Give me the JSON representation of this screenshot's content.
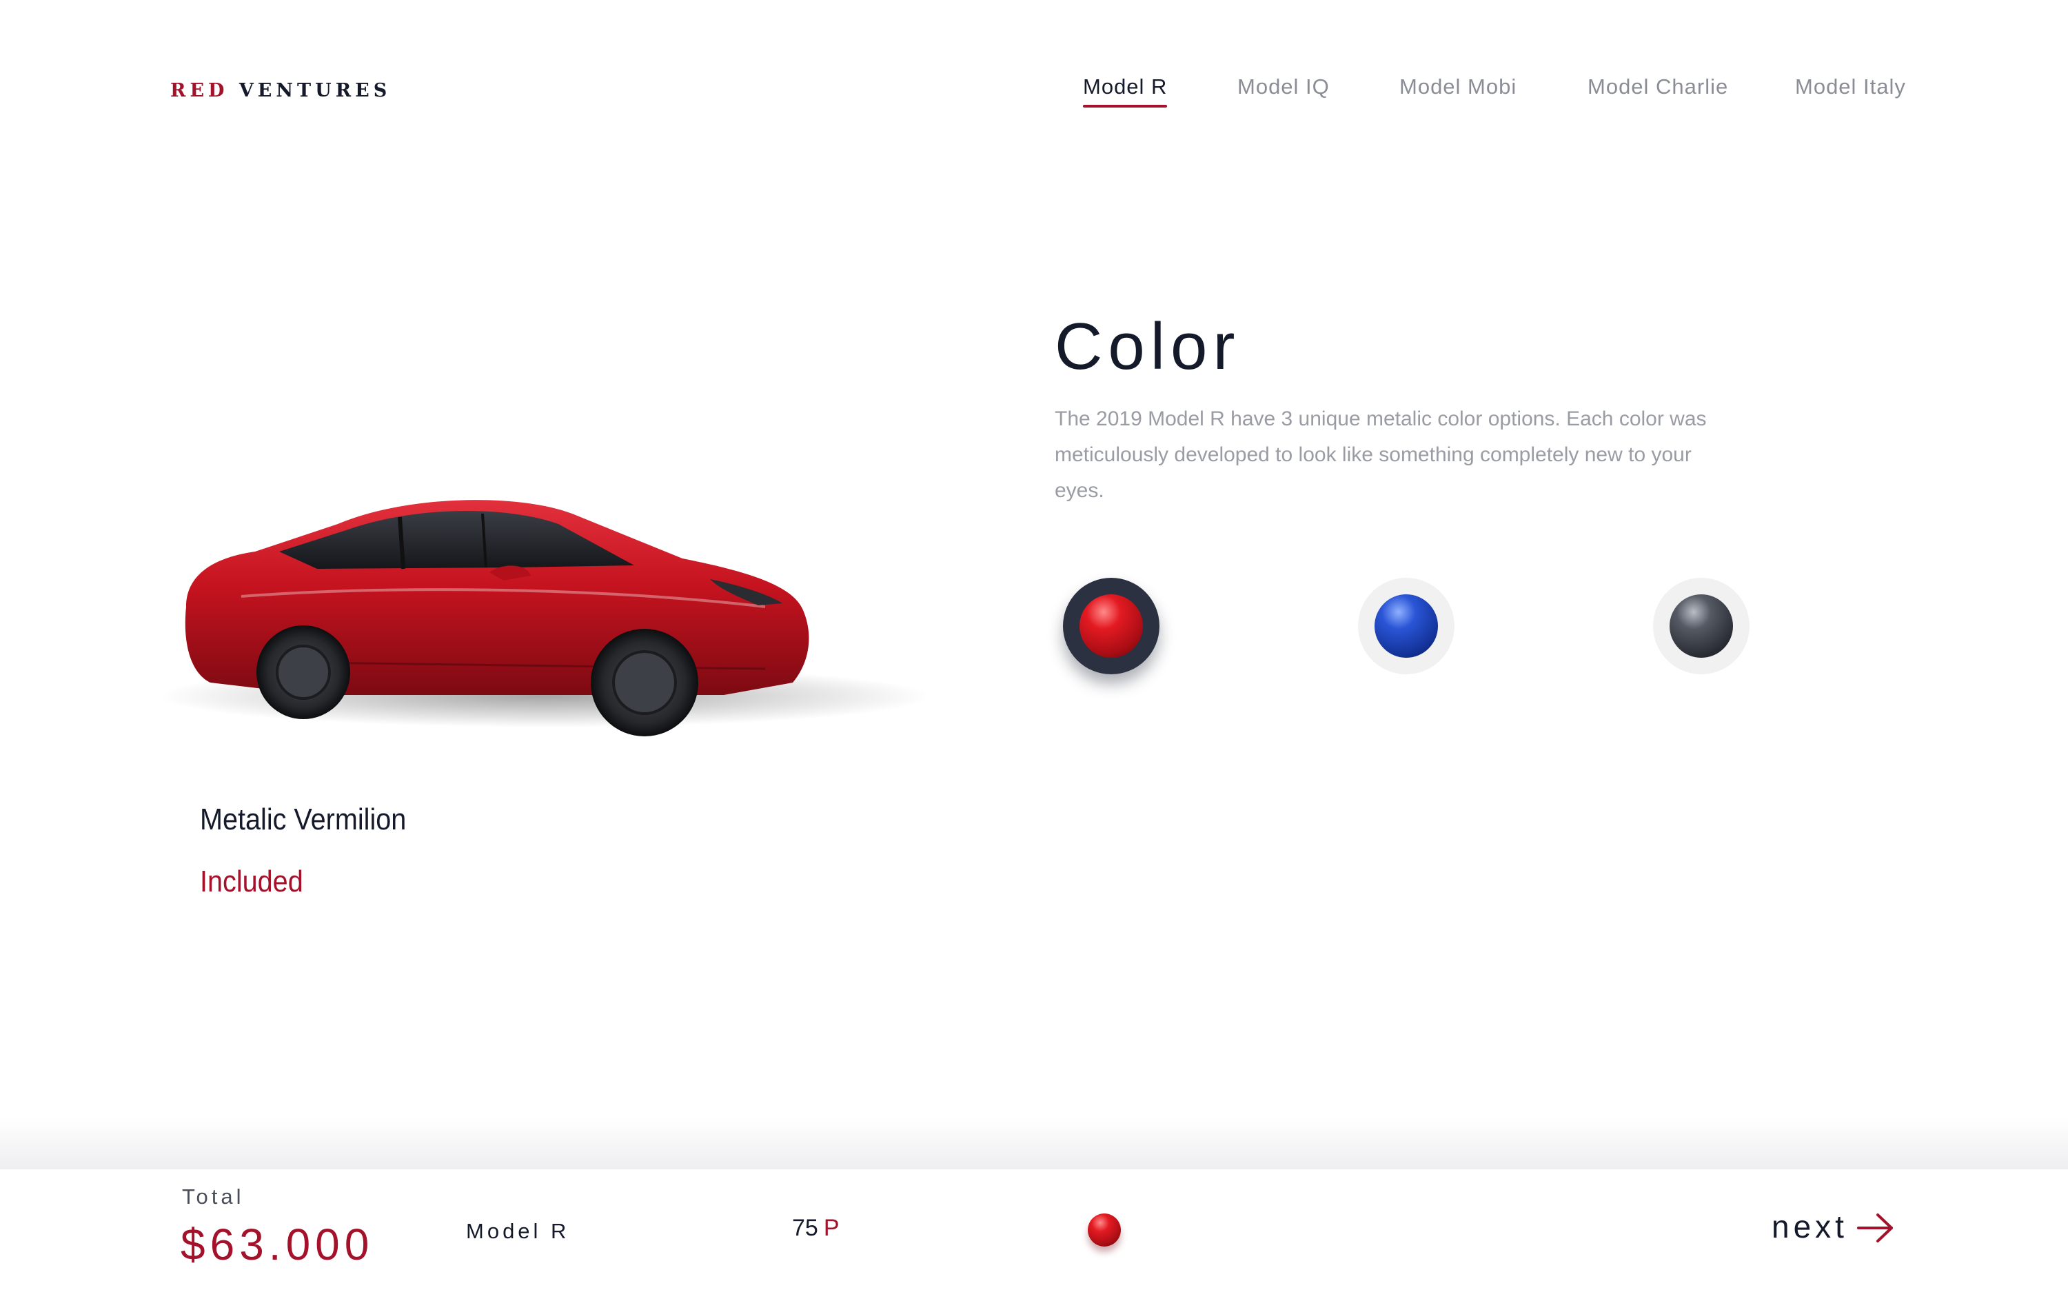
{
  "brand": {
    "part1": "RED",
    "part2": "VENTURES",
    "accent_color": "#a3122a",
    "dark_color": "#141a2a"
  },
  "nav": {
    "items": [
      {
        "label": "Model R",
        "active": true
      },
      {
        "label": "Model IQ",
        "active": false
      },
      {
        "label": "Model Mobi",
        "active": false
      },
      {
        "label": "Model Charlie",
        "active": false
      },
      {
        "label": "Model Italy",
        "active": false
      }
    ]
  },
  "section": {
    "title": "Color",
    "description": "The 2019 Model R have 3 unique metalic color options. Each color was meticulously developed to look like something completely new to your eyes."
  },
  "selected_color": {
    "name": "Metalic Vermilion",
    "price_note": "Included"
  },
  "swatches": [
    {
      "icon": "red-paint-sphere-icon",
      "color": "#d4151c",
      "selected": true
    },
    {
      "icon": "blue-paint-sphere-icon",
      "color": "#1a3fae",
      "selected": false
    },
    {
      "icon": "graphite-paint-sphere-icon",
      "color": "#2f333b",
      "selected": false
    }
  ],
  "footer": {
    "total_label": "Total",
    "total_value": "$63.000",
    "model": "Model R",
    "battery_value": "75",
    "battery_unit": "P",
    "selected_color_icon": "red-paint-sphere-icon",
    "next_label": "next",
    "next_icon": "arrow-right-icon"
  }
}
